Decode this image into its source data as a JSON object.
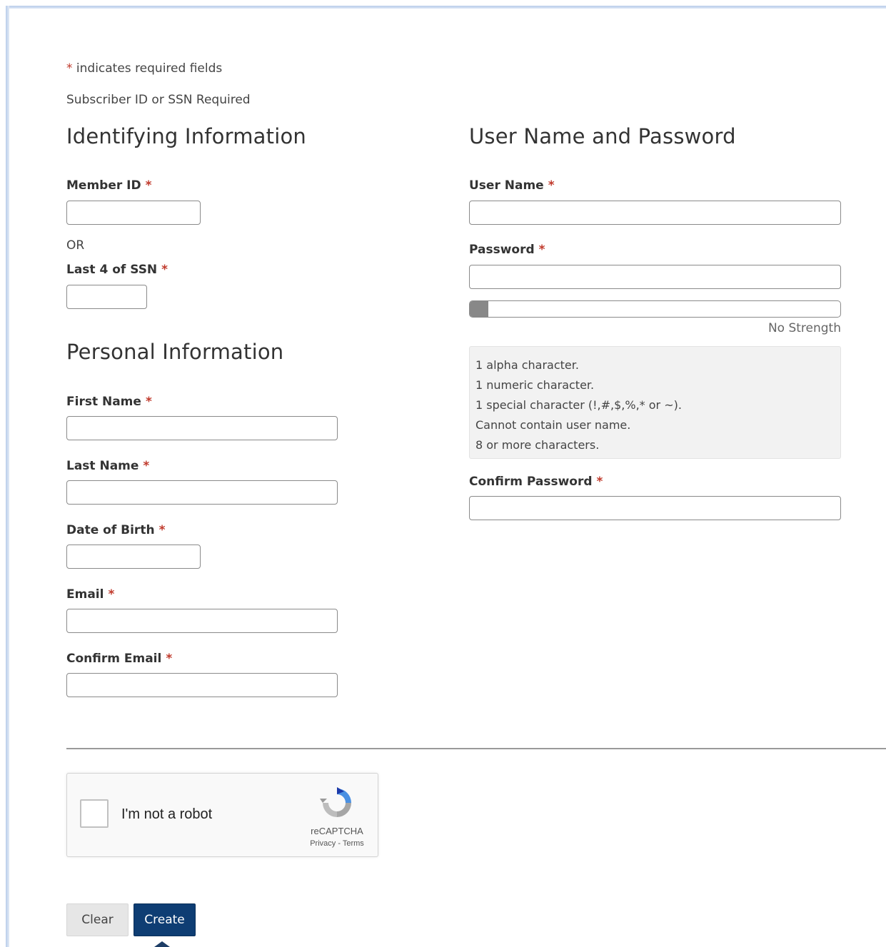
{
  "intro": {
    "required_star": "*",
    "required_note": "indicates required fields",
    "subscriber_note": "Subscriber ID or SSN Required"
  },
  "identifying": {
    "title": "Identifying Information",
    "member_id_label": "Member ID",
    "or_text": "OR",
    "ssn_label": "Last 4 of SSN"
  },
  "personal": {
    "title": "Personal Information",
    "first_name_label": "First Name",
    "last_name_label": "Last Name",
    "dob_label": "Date of Birth",
    "email_label": "Email",
    "confirm_email_label": "Confirm Email"
  },
  "credentials": {
    "title": "User Name and Password",
    "username_label": "User Name",
    "password_label": "Password",
    "strength_text": "No Strength",
    "strength_fraction": 0.05,
    "rules": [
      "1 alpha character.",
      "1 numeric character.",
      "1 special character (!,#,$,%,* or ~).",
      "Cannot contain user name.",
      "8 or more characters."
    ],
    "confirm_password_label": "Confirm Password"
  },
  "required_marker": "*",
  "captcha": {
    "label": "I'm not a robot",
    "brand": "reCAPTCHA",
    "links": "Privacy - Terms"
  },
  "buttons": {
    "clear": "Clear",
    "create": "Create"
  },
  "colors": {
    "required": "#c0392b",
    "primary_button": "#0e3d73",
    "secondary_button": "#e6e6e6",
    "rules_background": "#f2f2f2"
  }
}
